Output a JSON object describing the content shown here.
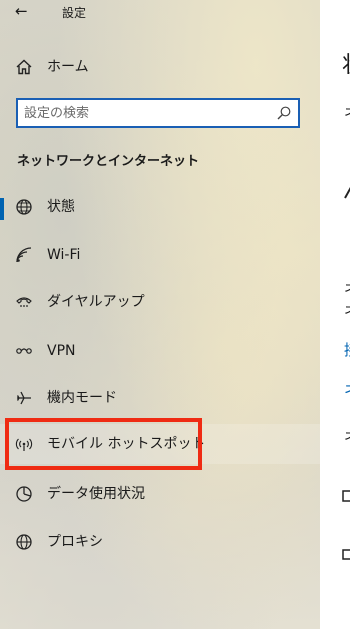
{
  "window": {
    "title": "設定",
    "back_glyph": "←"
  },
  "home": {
    "label": "ホーム",
    "icon": "home-icon"
  },
  "search": {
    "placeholder": "設定の検索",
    "value": "",
    "icon": "search-icon"
  },
  "section": {
    "title": "ネットワークとインターネット"
  },
  "nav": {
    "items": [
      {
        "label": "状態",
        "icon": "globe-status-icon",
        "selected": true
      },
      {
        "label": "Wi-Fi",
        "icon": "wifi-icon"
      },
      {
        "label": "ダイヤルアップ",
        "icon": "dialup-icon"
      },
      {
        "label": "VPN",
        "icon": "vpn-icon"
      },
      {
        "label": "機内モード",
        "icon": "airplane-icon"
      },
      {
        "label": "モバイル ホットスポット",
        "icon": "hotspot-icon",
        "highlighted": true
      },
      {
        "label": "データ使用状況",
        "icon": "data-usage-icon"
      },
      {
        "label": "プロキシ",
        "icon": "proxy-globe-icon"
      }
    ]
  },
  "main_fragments": {
    "title": "状",
    "line1": "ネ",
    "line2": "ネ",
    "line3": "ネ",
    "link1": "接",
    "link2": "ネ",
    "line4": "ネ"
  },
  "colors": {
    "accent": "#0063b1",
    "highlight": "#ef2b13",
    "search_border": "#1a5fb4"
  }
}
